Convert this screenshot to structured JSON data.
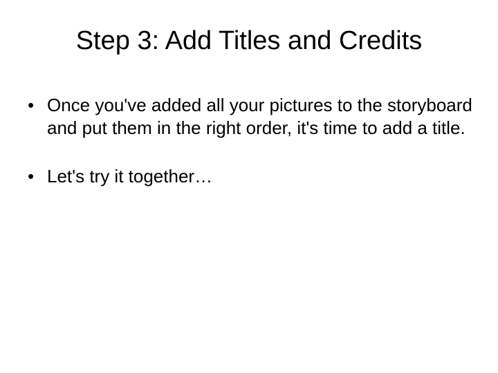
{
  "slide": {
    "title": "Step 3: Add Titles and Credits",
    "bullets": [
      "Once you've added all your pictures to the storyboard and put them in the right order, it's time to add a title.",
      "Let's try it together…"
    ]
  }
}
